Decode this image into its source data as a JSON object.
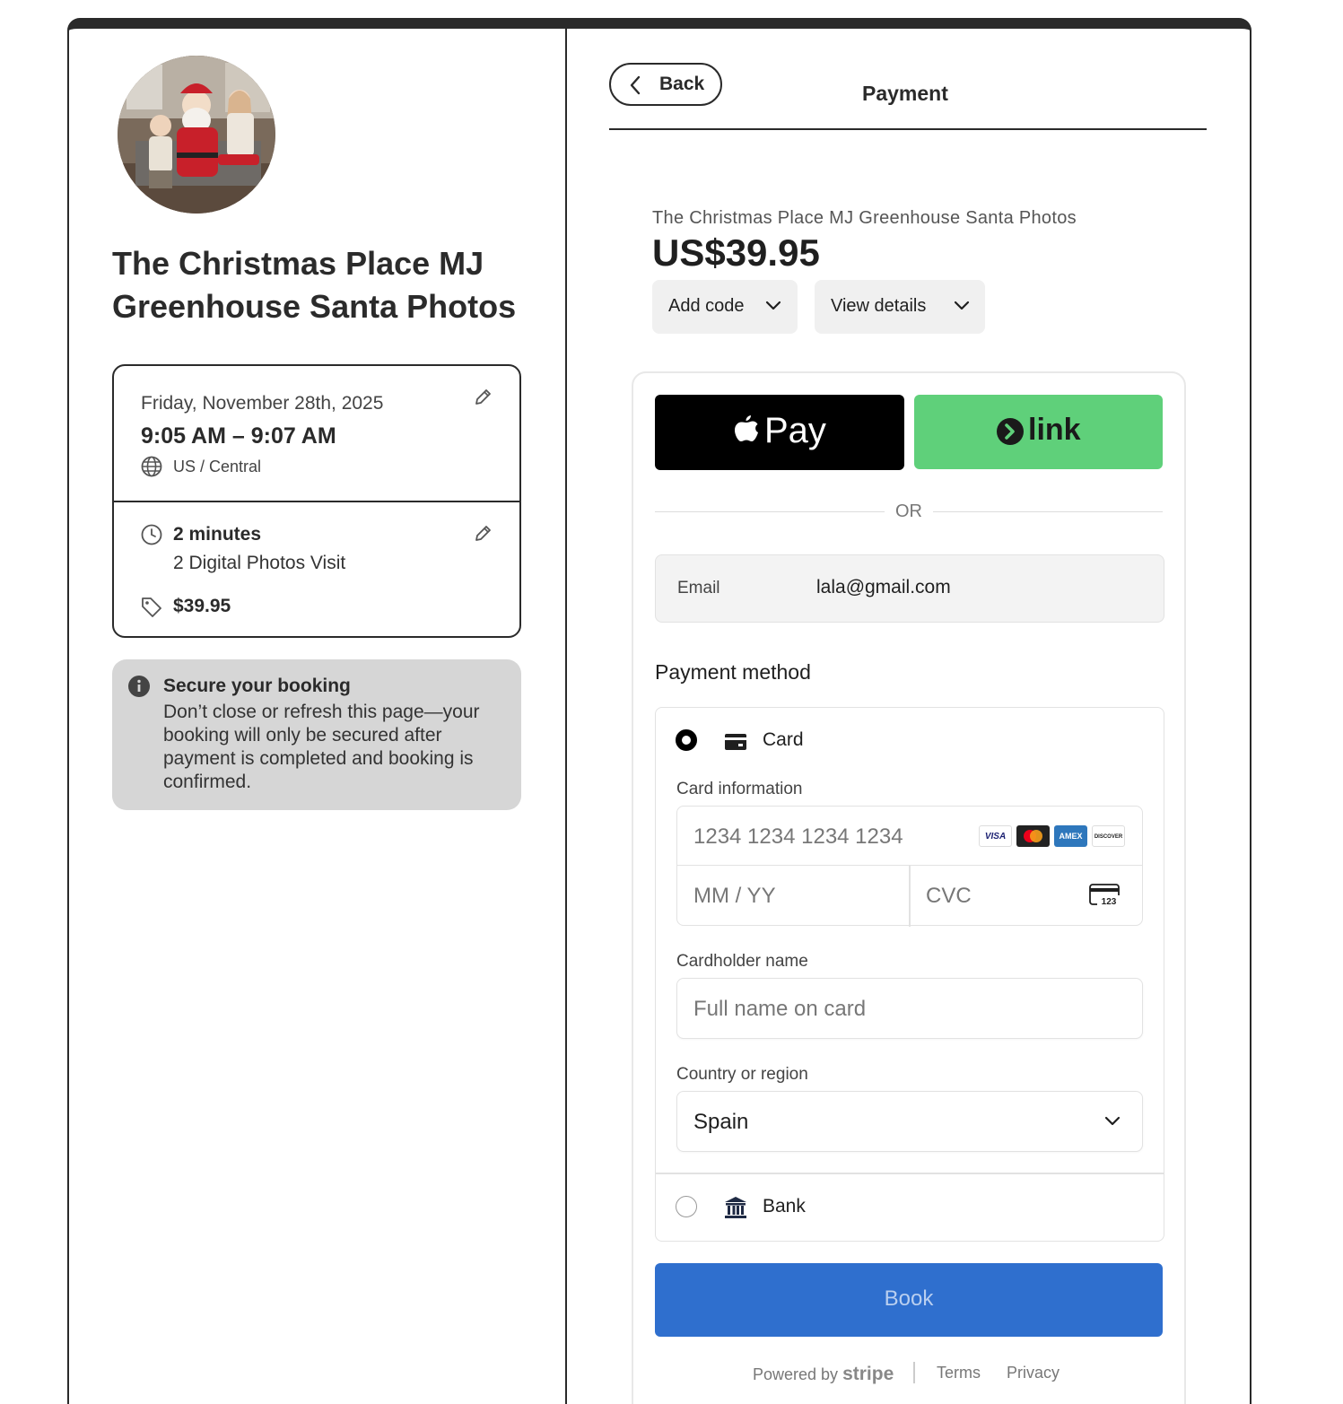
{
  "event": {
    "title": "The Christmas Place MJ Greenhouse Santa Photos",
    "date": "Friday, November 28th, 2025",
    "time_range": "9:05 AM – 9:07 AM",
    "timezone": "US / Central",
    "duration": "2 minutes",
    "service": "2 Digital Photos Visit",
    "price": "$39.95"
  },
  "notice": {
    "title": "Secure your booking",
    "body": "Don’t close or refresh this page—your booking will only be secured after payment is completed and booking is confirmed."
  },
  "header": {
    "back_label": "Back",
    "title": "Payment"
  },
  "checkout": {
    "merchant": "The Christmas Place MJ Greenhouse Santa Photos",
    "amount": "US$39.95",
    "add_code_label": "Add code",
    "view_details_label": "View details",
    "apple_pay_label": "Pay",
    "link_label": "link",
    "or_label": "OR",
    "email_label": "Email",
    "email_value": "lala@gmail.com",
    "payment_method_title": "Payment method",
    "card_option_label": "Card",
    "card_info_label": "Card information",
    "card_number_placeholder": "1234 1234 1234 1234",
    "expiry_placeholder": "MM / YY",
    "cvc_placeholder": "CVC",
    "card_brands": [
      "VISA",
      "mastercard",
      "AMEX",
      "DISCOVER"
    ],
    "cardholder_label": "Cardholder name",
    "cardholder_placeholder": "Full name on card",
    "country_label": "Country or region",
    "country_value": "Spain",
    "bank_option_label": "Bank",
    "book_label": "Book",
    "powered_by": "Powered by",
    "stripe": "stripe",
    "terms": "Terms",
    "privacy": "Privacy"
  },
  "colors": {
    "book_button": "#2f6fce",
    "link_button": "#5fd07a",
    "apple_pay_button": "#000000",
    "notice_bg": "#d6d6d6"
  }
}
